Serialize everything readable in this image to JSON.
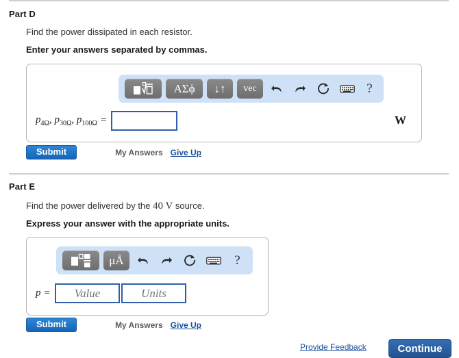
{
  "parts": [
    {
      "heading": "Part D",
      "question": "Find the power dissipated in each resistor.",
      "instruction": "Enter your answers separated by commas.",
      "equation": {
        "symbol": "p",
        "subscripts": "4Ω, 30Ω, 100Ω",
        "label_plain": "p4Ω, p30Ω, p100Ω",
        "equals": "=",
        "terms": [
          {
            "symbol": "p",
            "sub": "4Ω"
          },
          {
            "symbol": "p",
            "sub": "30Ω"
          },
          {
            "symbol": "p",
            "sub": "100Ω"
          }
        ]
      },
      "answer_value": "",
      "answer_placeholder": "",
      "unit_suffix": "W",
      "toolbar": [
        {
          "name": "math-template-icon",
          "label": "",
          "type": "glyph-root"
        },
        {
          "name": "greek-symbols-button",
          "label": "ΑΣϕ",
          "type": "text"
        },
        {
          "name": "sort-arrows-button",
          "label": "↓↑",
          "type": "text"
        },
        {
          "name": "vector-button",
          "label": "vec",
          "type": "text"
        },
        {
          "name": "undo-icon",
          "label": "",
          "type": "undo"
        },
        {
          "name": "redo-icon",
          "label": "",
          "type": "redo"
        },
        {
          "name": "reset-icon",
          "label": "",
          "type": "reset"
        },
        {
          "name": "keyboard-icon",
          "label": "",
          "type": "keyboard"
        },
        {
          "name": "help-icon",
          "label": "?",
          "type": "help"
        }
      ],
      "submit_label": "Submit",
      "my_answers_label": "My Answers",
      "give_up_label": "Give Up"
    },
    {
      "heading": "Part E",
      "question_prefix": "Find the power delivered by the ",
      "question_value": "40 V",
      "question_suffix": " source.",
      "question_plain": "Find the power delivered by the 40 V source.",
      "instruction": "Express your answer with the appropriate units.",
      "equation": {
        "symbol": "p",
        "equals": "="
      },
      "value_placeholder": "Value",
      "units_placeholder": "Units",
      "value_text": "",
      "units_text": "",
      "toolbar": [
        {
          "name": "math-template-icon",
          "label": "",
          "type": "glyph-frac"
        },
        {
          "name": "units-button",
          "label": "μÅ",
          "type": "text"
        },
        {
          "name": "undo-icon",
          "label": "",
          "type": "undo"
        },
        {
          "name": "redo-icon",
          "label": "",
          "type": "redo"
        },
        {
          "name": "reset-icon",
          "label": "",
          "type": "reset"
        },
        {
          "name": "keyboard-icon",
          "label": "",
          "type": "keyboard"
        },
        {
          "name": "help-icon",
          "label": "?",
          "type": "help"
        }
      ],
      "submit_label": "Submit",
      "my_answers_label": "My Answers",
      "give_up_label": "Give Up"
    }
  ],
  "footer": {
    "feedback_label": "Provide Feedback",
    "continue_label": "Continue"
  },
  "colors": {
    "toolbar_bg": "#cfe1f7",
    "submit_blue": "#1565b8",
    "continue_blue": "#24538f",
    "link_blue": "#1a4f9c",
    "input_border": "#2f5fa8",
    "panel_border": "#b6b6b6",
    "divider": "#cfcfcf"
  }
}
